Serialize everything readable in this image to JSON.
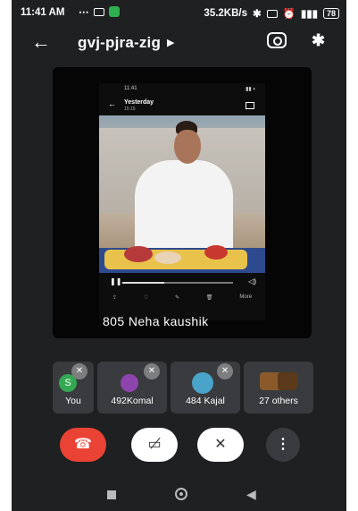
{
  "status_bar": {
    "time": "11:41 AM",
    "network_speed": "35.2KB/s",
    "battery": "78"
  },
  "app_bar": {
    "meeting_code": "gvj-pjra-zig"
  },
  "shared_screen": {
    "inner_time": "11:41",
    "inner_title": "Yesterday",
    "inner_subtitle": "15:15",
    "nav_more": "More",
    "seek_progress": 0.38
  },
  "speaker": {
    "name": "805 Neha kaushik"
  },
  "participants": [
    {
      "label": "You",
      "avatar_letter": "S",
      "avatar_color": "#34a853"
    },
    {
      "label": "492Komal",
      "avatar_color": "#8e44ad"
    },
    {
      "label": "484 Kajal",
      "avatar_color": "#4aa3c8"
    },
    {
      "label": "27 others"
    }
  ],
  "controls": {
    "end_color": "#ea4335"
  }
}
